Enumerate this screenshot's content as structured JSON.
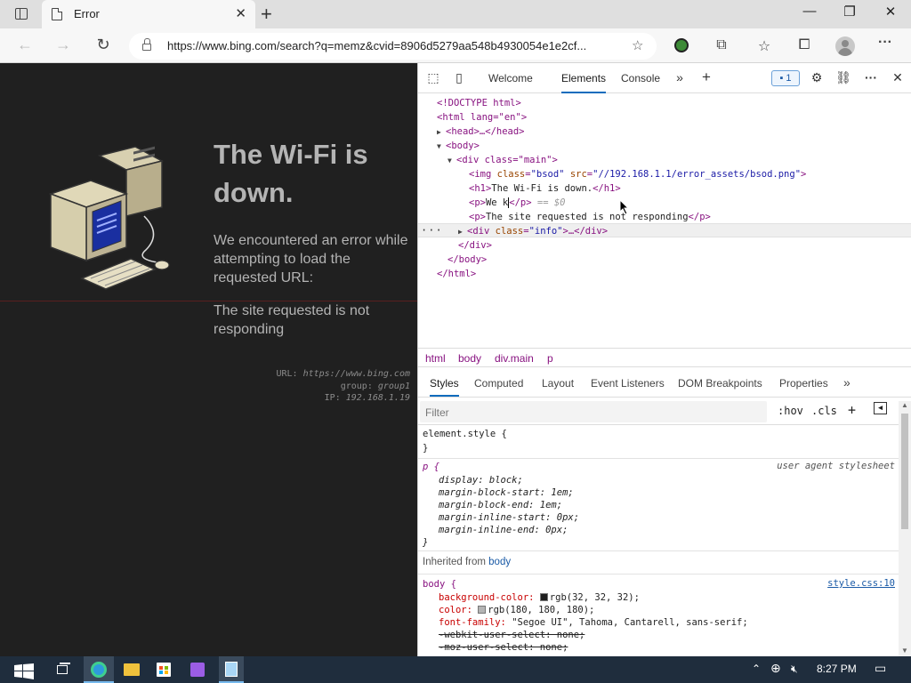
{
  "browser": {
    "tab_title": "Error",
    "url": "https://www.bing.com/search?q=memz&cvid=8906d5279aa548b4930054e1e2cf..."
  },
  "page": {
    "heading": "The Wi-Fi is down.",
    "paragraph1": "We encountered an error while attempting to load the requested URL:",
    "paragraph2": "The site requested is not responding",
    "info_url_label": "URL:",
    "info_url_value": "https://www.bing.com",
    "info_group_label": "group:",
    "info_group_value": "group1",
    "info_ip_label": "IP:",
    "info_ip_value": "192.168.1.19"
  },
  "devtools": {
    "tabs": [
      "Welcome",
      "Elements",
      "Console"
    ],
    "active_tab": "Elements",
    "issues_count": "1",
    "dom": {
      "doctype": "<!DOCTYPE html>",
      "html_open": "<html lang=\"en\">",
      "head": "<head>…</head>",
      "body_open": "<body>",
      "div_main_open": "<div class=\"main\">",
      "img_tag_open": "<img",
      "img_class_attr": "class",
      "img_class_val": "\"bsod\"",
      "img_src_attr": "src",
      "img_src_val": "\"//192.168.1.1/error_assets/bsod.png\"",
      "img_tag_close": ">",
      "h1_open": "<h1>",
      "h1_text": "The Wi-Fi is down.",
      "h1_close": "</h1>",
      "p_open": "<p>",
      "p_text": "We k",
      "p_close": "</p>",
      "p_eq": "== $0",
      "p2_text": "The site requested is not responding",
      "div_info_open": "<div",
      "div_info_attr": "class",
      "div_info_val": "\"info\"",
      "div_info_rest": ">…</div>",
      "div_close": "</div>",
      "body_close": "</body>",
      "html_close": "</html>"
    },
    "breadcrumbs": [
      "html",
      "body",
      "div.main",
      "p"
    ],
    "style_tabs": [
      "Styles",
      "Computed",
      "Layout",
      "Event Listeners",
      "DOM Breakpoints",
      "Properties"
    ],
    "filter_placeholder": "Filter",
    "hov": ":hov",
    "cls": ".cls",
    "styles": {
      "element_style": "element.style {",
      "close_brace": "}",
      "ua_selector": "p {",
      "ua_source": "user agent stylesheet",
      "ua_props": [
        "display: block;",
        "margin-block-start: 1em;",
        "margin-block-end: 1em;",
        "margin-inline-start: 0px;",
        "margin-inline-end: 0px;"
      ],
      "inherited_label": "Inherited from",
      "inherited_el": "body",
      "body_selector": "body {",
      "body_source": "style.css:10",
      "bg_prop": "background-color:",
      "bg_val": "rgb(32, 32, 32);",
      "color_prop": "color:",
      "color_val": "rgb(180, 180, 180);",
      "font_prop": "font-family:",
      "font_val": "\"Segoe UI\", Tahoma, Cantarell, sans-serif;",
      "webkit_select": "-webkit-user-select: none;",
      "moz_select": "-moz-user-select: none;"
    }
  },
  "taskbar": {
    "time": "8:27 PM"
  },
  "colors": {
    "page_bg": "#202020",
    "page_text": "#b4b4b4",
    "accent": "#0f6cbd"
  }
}
